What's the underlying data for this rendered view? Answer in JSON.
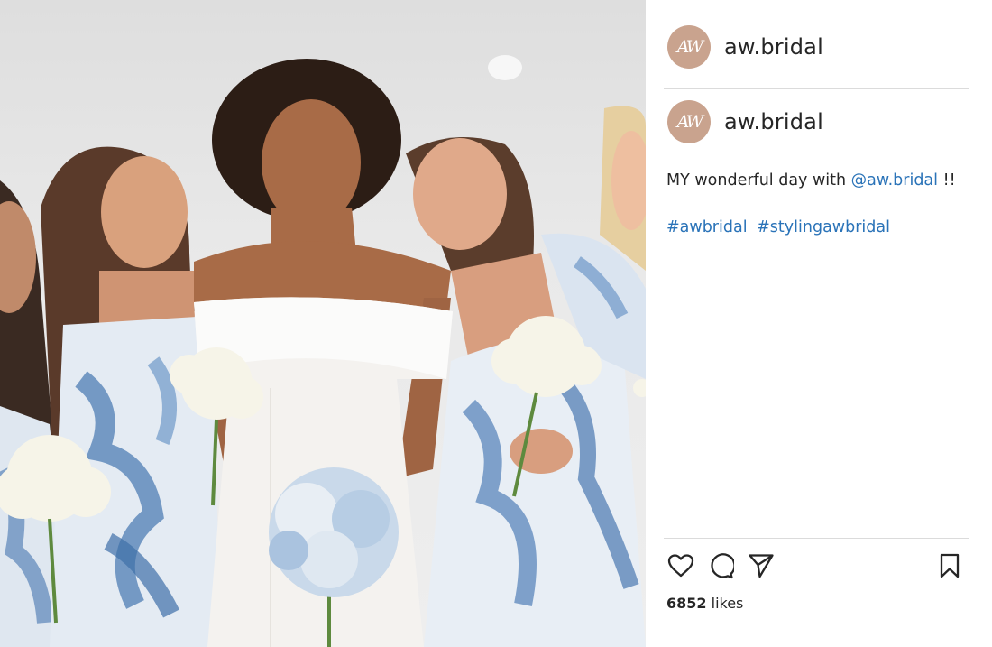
{
  "post": {
    "username": "aw.bridal",
    "avatar_initials": "AW",
    "caption_text": "MY wonderful day with ",
    "caption_mention": "@aw.bridal",
    "caption_suffix": " !!",
    "hashtags": [
      "#awbridal",
      "#stylingawbridal"
    ],
    "likes_count": "6852",
    "likes_label": " likes"
  },
  "icons": {
    "like": "heart-icon",
    "comment": "comment-icon",
    "share": "paper-plane-icon",
    "save": "bookmark-icon"
  },
  "colors": {
    "link": "#2a73b8",
    "avatar_bg": "#c9a38e",
    "divider": "#dbdbdb",
    "text": "#262626"
  }
}
